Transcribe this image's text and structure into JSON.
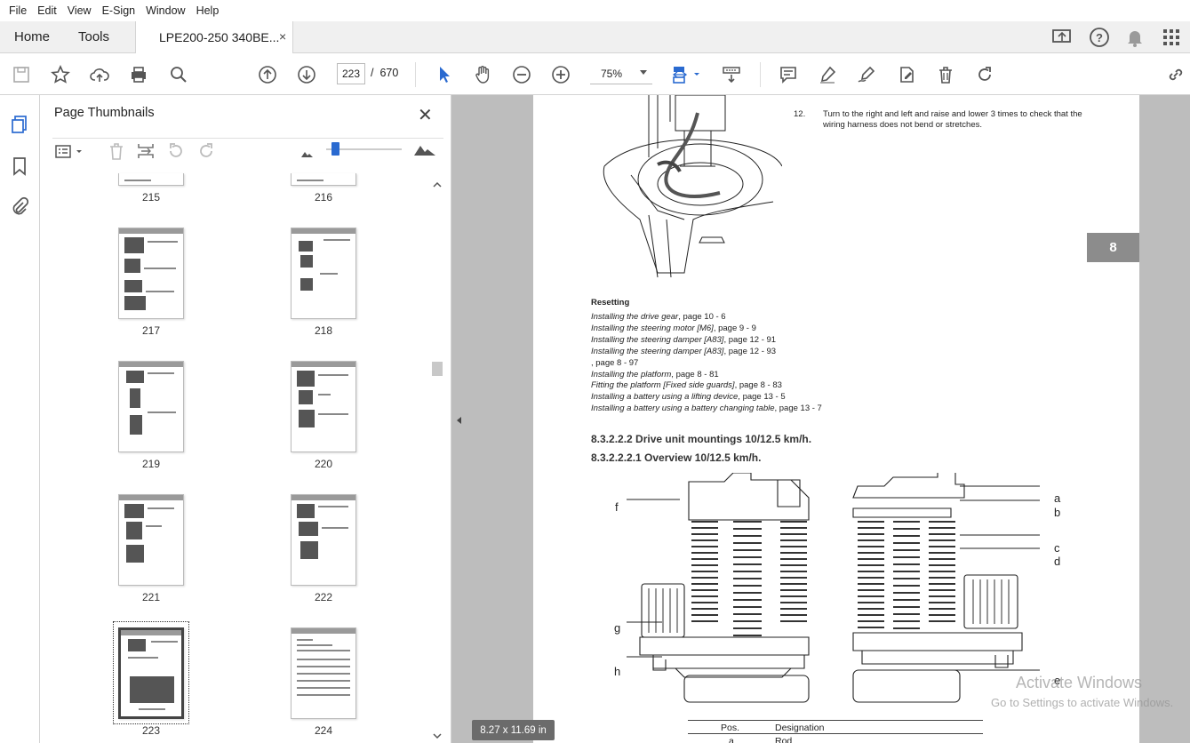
{
  "menu": [
    "File",
    "Edit",
    "View",
    "E-Sign",
    "Window",
    "Help"
  ],
  "tabs": {
    "home": "Home",
    "tools": "Tools",
    "document": "LPE200-250 340BE...",
    "close": "×"
  },
  "toolbar": {
    "current_page": "223",
    "page_sep": "/",
    "total_pages": "670",
    "zoom": "75%"
  },
  "thumbnails": {
    "title": "Page Thumbnails",
    "close": "✕",
    "pages": [
      "215",
      "216",
      "217",
      "218",
      "219",
      "220",
      "221",
      "222",
      "223",
      "224"
    ],
    "selected": "223"
  },
  "document": {
    "side_badge": "8",
    "step12_num": "12.",
    "step12_text": "Turn to the right and left and raise and lower 3 times to check that the wiring harness does not bend or stretches.",
    "resetting_title": "Resetting",
    "references": [
      {
        "link": "Installing the drive gear",
        "tail": ", page 10 - 6"
      },
      {
        "link": "Installing the steering motor [M6]",
        "tail": ", page 9 - 9"
      },
      {
        "link": "Installing the steering damper [A83]",
        "tail": ", page 12 - 91"
      },
      {
        "link": "Installing the steering damper [A83]",
        "tail": ", page 12 - 93"
      },
      {
        "link": "",
        "tail": ", page 8 - 97"
      },
      {
        "link": "Installing the platform",
        "tail": ", page 8 - 81"
      },
      {
        "link": "Fitting the platform [Fixed side guards]",
        "tail": ", page 8 - 83"
      },
      {
        "link": "Installing a battery using a lifting device",
        "tail": ", page 13 - 5"
      },
      {
        "link": "Installing a battery using a battery changing table",
        "tail": ", page 13 - 7"
      }
    ],
    "heading1": "8.3.2.2.2 Drive unit mountings 10/12.5 km/h.",
    "heading2": "8.3.2.2.2.1  Overview 10/12.5 km/h.",
    "labels_left": [
      "f",
      "g",
      "h"
    ],
    "labels_right": [
      "a",
      "b",
      "c",
      "d",
      "e"
    ],
    "table_headers": [
      "Pos.",
      "Designation"
    ],
    "table_row1": [
      "a",
      "Rod"
    ]
  },
  "status": {
    "page_size": "8.27 x 11.69 in"
  },
  "watermark": {
    "line1": "Activate Windows",
    "line2": "Go to Settings to activate Windows."
  },
  "colors": {
    "accent": "#2a6ad0",
    "doc_bg": "#bdbdbd",
    "badge": "#8c8c8c"
  }
}
